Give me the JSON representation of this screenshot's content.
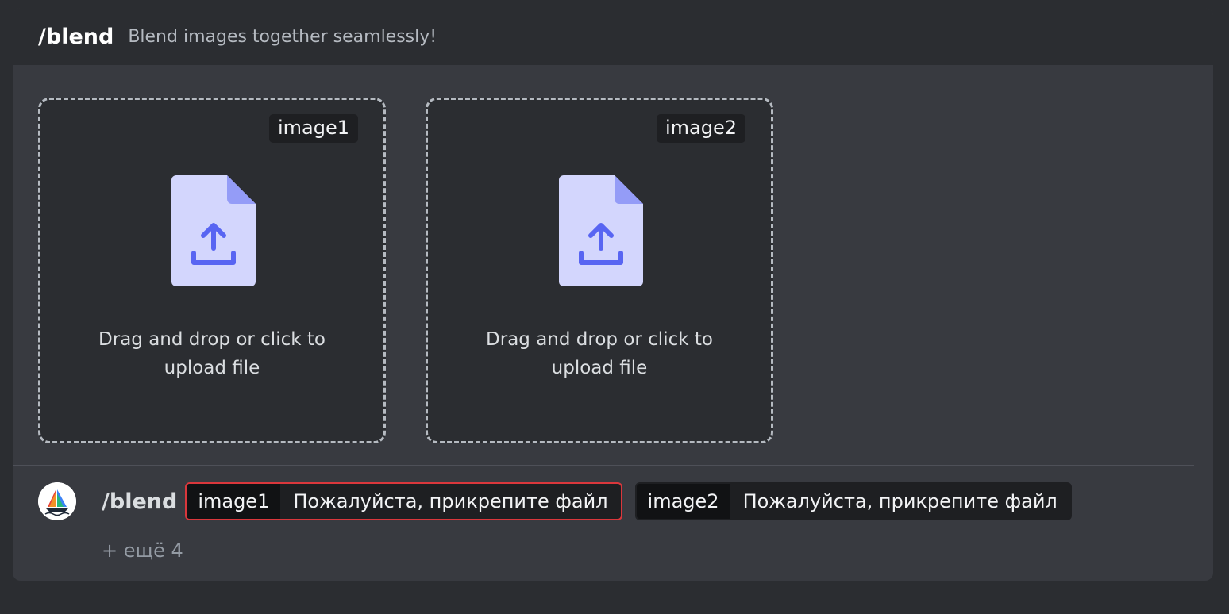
{
  "header": {
    "command": "/blend",
    "description": "Blend images together seamlessly!"
  },
  "uploads": [
    {
      "label": "image1",
      "text_line1": "Drag and drop or click to",
      "text_line2": "upload file"
    },
    {
      "label": "image2",
      "text_line1": "Drag and drop or click to",
      "text_line2": "upload file"
    }
  ],
  "input": {
    "command": "/blend",
    "options": [
      {
        "name": "image1",
        "value": "Пожалуйста, прикрепите файл",
        "state": "error"
      },
      {
        "name": "image2",
        "value": "Пожалуйста, прикрепите файл",
        "state": "normal"
      }
    ],
    "more": "+ ещё 4"
  },
  "icons": {
    "file_upload": "file-upload-icon",
    "avatar": "midjourney-boat-logo"
  },
  "colors": {
    "accent": "#5865f2",
    "file_body": "#d3d6fd",
    "file_fold": "#949cf7",
    "error": "#da373c"
  }
}
